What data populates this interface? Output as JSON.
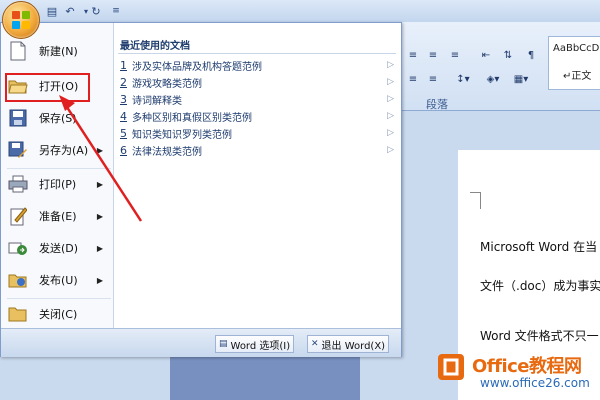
{
  "ribbon": {
    "group_label": "段落",
    "style_preview": "AaBbCcD",
    "style_name": "↵正文"
  },
  "document": {
    "line1": "Microsoft Word 在当",
    "line2": "文件（.doc）成为事实",
    "line3": "Word 文件格式不只一"
  },
  "menu": {
    "items": [
      {
        "label": "新建(N)",
        "icon": "new-document-icon"
      },
      {
        "label": "打开(O)",
        "icon": "open-folder-icon"
      },
      {
        "label": "保存(S)",
        "icon": "save-disk-icon"
      },
      {
        "label": "另存为(A)",
        "icon": "save-as-icon"
      },
      {
        "label": "打印(P)",
        "icon": "printer-icon"
      },
      {
        "label": "准备(E)",
        "icon": "prepare-icon"
      },
      {
        "label": "发送(D)",
        "icon": "send-icon"
      },
      {
        "label": "发布(U)",
        "icon": "publish-icon"
      },
      {
        "label": "关闭(C)",
        "icon": "close-folder-icon"
      }
    ],
    "recent_title": "最近使用的文档",
    "recent": [
      {
        "num": "1",
        "name": "涉及实体品牌及机构答题范例"
      },
      {
        "num": "2",
        "name": "游戏攻略类范例"
      },
      {
        "num": "3",
        "name": "诗词解释类"
      },
      {
        "num": "4",
        "name": "多种区别和真假区别类范例"
      },
      {
        "num": "5",
        "name": "知识类知识罗列类范例"
      },
      {
        "num": "6",
        "name": "法律法规类范例"
      }
    ],
    "word_options": "Word 选项(I)",
    "exit_word": "退出 Word(X)"
  },
  "watermark": {
    "brand": "Office教程网",
    "url": "www.office26.com"
  },
  "colors": {
    "highlight": "#e02020",
    "menu_text": "#1e3c6e"
  }
}
